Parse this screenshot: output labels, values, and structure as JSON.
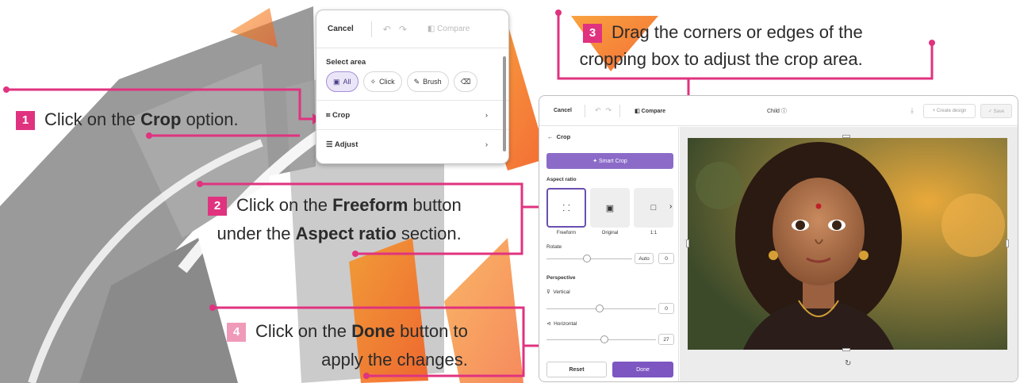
{
  "steps": [
    {
      "num": "1",
      "pre": "Click on the ",
      "bold": "Crop",
      "post": " option."
    },
    {
      "num": "2",
      "line1_pre": "Click on the ",
      "line1_bold": "Freeform",
      "line1_post": " button",
      "line2_pre": "under the ",
      "line2_bold": "Aspect ratio",
      "line2_post": " section."
    },
    {
      "num": "3",
      "line1": "Drag the corners or edges of the",
      "line2": "cropping box to adjust the crop area."
    },
    {
      "num": "4",
      "line1_pre": "Click on the ",
      "line1_bold": "Done",
      "line1_post": " button to",
      "line2": "apply the changes."
    }
  ],
  "panel": {
    "cancel": "Cancel",
    "compare": "Compare",
    "select_area": "Select area",
    "chips": [
      "All",
      "Click",
      "Brush"
    ],
    "crop": "Crop",
    "adjust": "Adjust"
  },
  "editor": {
    "cancel": "Cancel",
    "compare": "Compare",
    "file_name": "Child",
    "create_design": "+ Create design",
    "save": "✓ Save",
    "crop_title": "Crop",
    "smart_crop": "Smart Crop",
    "aspect_ratio": "Aspect ratio",
    "ratios": [
      "Freeform",
      "Original",
      "1:1"
    ],
    "rotate": "Rotate",
    "rotate_mode": "Auto",
    "rotate_value": "0",
    "perspective": "Perspective",
    "vertical": "Vertical",
    "vertical_value": "0",
    "horizontal": "Horizontal",
    "horizontal_value": "27",
    "reset": "Reset",
    "done": "Done"
  },
  "colors": {
    "accent": "#e0337f",
    "purple": "#7d56c2",
    "watermark": "#f7931e"
  }
}
